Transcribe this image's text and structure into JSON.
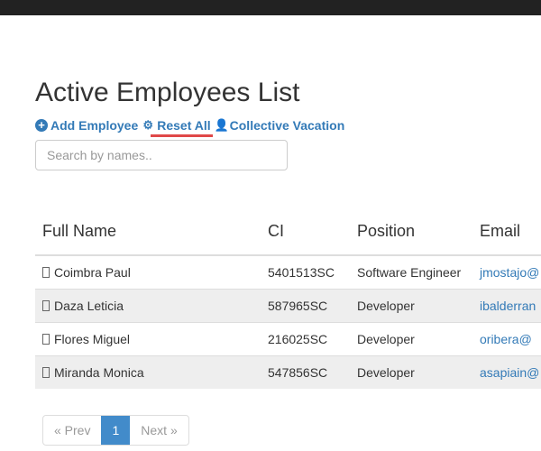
{
  "title": "Active Employees List",
  "actions": {
    "add": "Add Employee",
    "reset": "Reset All",
    "vacation": "Collective Vacation"
  },
  "search": {
    "placeholder": "Search by names..",
    "value": ""
  },
  "table": {
    "headers": [
      "Full Name",
      "CI",
      "Position",
      "Email"
    ],
    "rows": [
      {
        "name": "Coimbra Paul",
        "ci": "5401513SC",
        "position": "Software Engineer",
        "email": "jmostajo@"
      },
      {
        "name": "Daza Leticia",
        "ci": "587965SC",
        "position": "Developer",
        "email": "ibalderran"
      },
      {
        "name": "Flores Miguel",
        "ci": "216025SC",
        "position": "Developer",
        "email": "oribera@"
      },
      {
        "name": "Miranda Monica",
        "ci": "547856SC",
        "position": "Developer",
        "email": "asapiain@"
      }
    ]
  },
  "pagination": {
    "prev": "« Prev",
    "current": "1",
    "next": "Next »"
  },
  "colors": {
    "link": "#337ab7",
    "active_page": "#428bca",
    "underline": "#e04848"
  }
}
